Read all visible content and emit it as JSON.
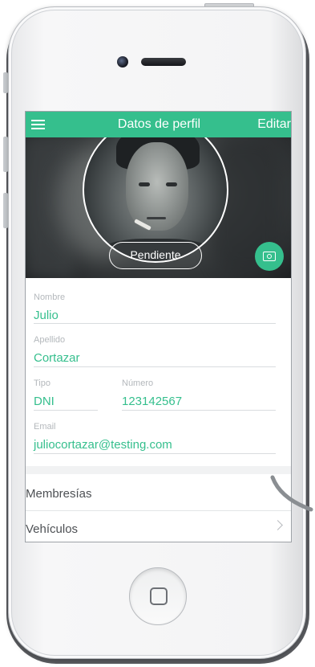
{
  "app": {
    "title": "Datos de perfil",
    "edit_label": "Editar"
  },
  "profile": {
    "status": "Pendiente"
  },
  "form": {
    "nombre": {
      "label": "Nombre",
      "value": "Julio"
    },
    "apellido": {
      "label": "Apellido",
      "value": "Cortazar"
    },
    "tipo": {
      "label": "Tipo",
      "value": "DNI"
    },
    "numero": {
      "label": "Número",
      "value": "123142567"
    },
    "email": {
      "label": "Email",
      "value": "juliocortazar@testing.com"
    }
  },
  "list": {
    "items": [
      {
        "label": "Membresías"
      },
      {
        "label": "Vehículos"
      }
    ]
  },
  "colors": {
    "accent": "#35bf8d",
    "label": "#b4b8bc",
    "text": "#4d5054"
  },
  "icons": {
    "menu": "hamburger-icon",
    "camera": "camera-icon",
    "chevron": "chevron-right-icon",
    "home": "home-button"
  }
}
